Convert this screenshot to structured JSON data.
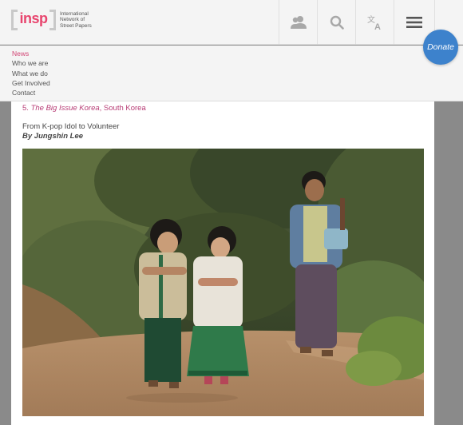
{
  "header": {
    "logo_word": "insp",
    "logo_line1": "International",
    "logo_line2": "Network of",
    "logo_line3": "Street Papers",
    "icons": [
      "users-icon",
      "search-icon",
      "translate-icon",
      "menu-icon"
    ],
    "donate_label": "Donate",
    "colors": {
      "logo_accent": "#e8456e",
      "donate_bg": "#3d82cc"
    }
  },
  "nav": {
    "items": [
      {
        "label": "News",
        "active": true
      },
      {
        "label": "Who we are"
      },
      {
        "label": "What we do"
      },
      {
        "label": "Get Involved"
      },
      {
        "label": "Contact"
      }
    ],
    "active_color": "#d24675"
  },
  "article": {
    "number": "5.",
    "publication": "The Big Issue Korea",
    "country": ", South Korea",
    "title": "From K-pop Idol to Volunteer",
    "author": "By Jungshin Lee"
  }
}
